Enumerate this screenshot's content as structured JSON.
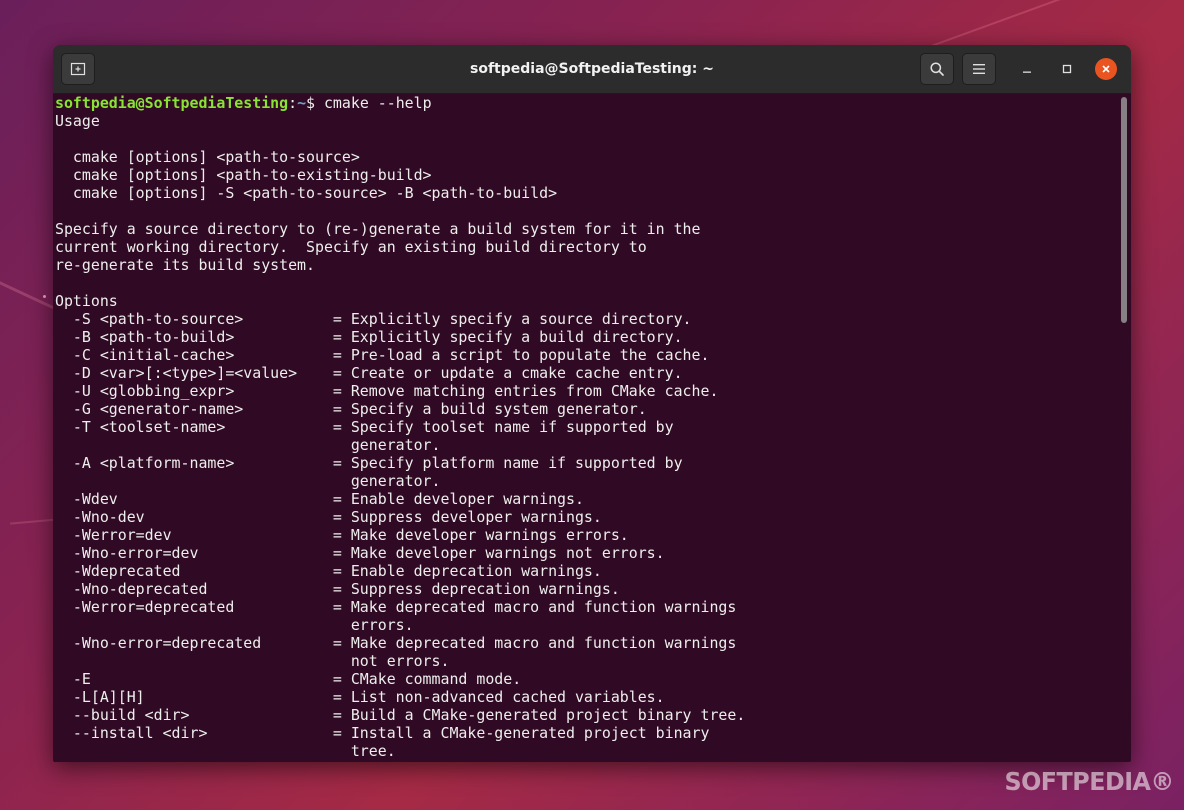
{
  "window": {
    "title": "softpedia@SoftpediaTesting: ~"
  },
  "titlebar": {
    "new_tab_icon": "new-tab-icon",
    "search_icon": "search-icon",
    "menu_icon": "hamburger-menu-icon",
    "minimize_icon": "minimize-icon",
    "maximize_icon": "maximize-icon",
    "close_icon": "close-icon"
  },
  "terminal": {
    "prompt": {
      "user_host": "softpedia@SoftpediaTesting",
      "separator": ":",
      "path": "~",
      "symbol": "$ ",
      "command": "cmake --help"
    },
    "lines": [
      "Usage",
      "",
      "  cmake [options] <path-to-source>",
      "  cmake [options] <path-to-existing-build>",
      "  cmake [options] -S <path-to-source> -B <path-to-build>",
      "",
      "Specify a source directory to (re-)generate a build system for it in the",
      "current working directory.  Specify an existing build directory to",
      "re-generate its build system.",
      "",
      "Options",
      "  -S <path-to-source>          = Explicitly specify a source directory.",
      "  -B <path-to-build>           = Explicitly specify a build directory.",
      "  -C <initial-cache>           = Pre-load a script to populate the cache.",
      "  -D <var>[:<type>]=<value>    = Create or update a cmake cache entry.",
      "  -U <globbing_expr>           = Remove matching entries from CMake cache.",
      "  -G <generator-name>          = Specify a build system generator.",
      "  -T <toolset-name>            = Specify toolset name if supported by",
      "                                 generator.",
      "  -A <platform-name>           = Specify platform name if supported by",
      "                                 generator.",
      "  -Wdev                        = Enable developer warnings.",
      "  -Wno-dev                     = Suppress developer warnings.",
      "  -Werror=dev                  = Make developer warnings errors.",
      "  -Wno-error=dev               = Make developer warnings not errors.",
      "  -Wdeprecated                 = Enable deprecation warnings.",
      "  -Wno-deprecated              = Suppress deprecation warnings.",
      "  -Werror=deprecated           = Make deprecated macro and function warnings",
      "                                 errors.",
      "  -Wno-error=deprecated        = Make deprecated macro and function warnings",
      "                                 not errors.",
      "  -E                           = CMake command mode.",
      "  -L[A][H]                     = List non-advanced cached variables.",
      "  --build <dir>                = Build a CMake-generated project binary tree.",
      "  --install <dir>              = Install a CMake-generated project binary",
      "                                 tree."
    ]
  },
  "watermark": "SOFTPEDIA®",
  "colors": {
    "terminal_bg": "#300a24",
    "prompt_user": "#8ae234",
    "prompt_path": "#729fcf",
    "text": "#eeeeec",
    "titlebar_bg": "#2c2c2c",
    "close_accent": "#e95420"
  }
}
